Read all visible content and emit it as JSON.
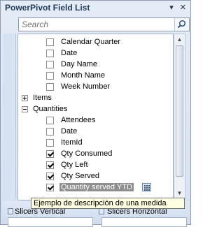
{
  "window": {
    "title": "PowerPivot Field List",
    "controls": [
      "▾",
      "✕"
    ]
  },
  "search": {
    "placeholder": "Search",
    "button_icon": "search-icon"
  },
  "fields": [
    {
      "label": "Calendar Quarter",
      "type": "field",
      "checked": false
    },
    {
      "label": "Date",
      "type": "field",
      "checked": false
    },
    {
      "label": "Day Name",
      "type": "field",
      "checked": false
    },
    {
      "label": "Month Name",
      "type": "field",
      "checked": false
    },
    {
      "label": "Week Number",
      "type": "field",
      "checked": false
    },
    {
      "label": "Items",
      "type": "table",
      "expanded": false
    },
    {
      "label": "Quantities",
      "type": "table",
      "expanded": true
    },
    {
      "label": "Attendees",
      "type": "field",
      "checked": false
    },
    {
      "label": "Date",
      "type": "field",
      "checked": false
    },
    {
      "label": "ItemId",
      "type": "field",
      "checked": false
    },
    {
      "label": "Qty Consumed",
      "type": "field",
      "checked": true
    },
    {
      "label": "Qty Left",
      "type": "field",
      "checked": true
    },
    {
      "label": "Qty Served",
      "type": "field",
      "checked": true
    },
    {
      "label": "Quantity served YTD",
      "type": "measure",
      "checked": true,
      "selected": true,
      "icon": "calculator-icon"
    }
  ],
  "slicers": {
    "vertical_label": "Slicers Vertical",
    "horizontal_label": "Slicers Horizontal"
  },
  "tooltip": {
    "text": "Ejemplo de descripción de una medida"
  },
  "colors": {
    "panel_bg": "#d5e1f2",
    "border": "#8e9db5",
    "title_text": "#1e395b",
    "selection": "#8f8f8f",
    "tooltip_bg": "#ffffe1"
  }
}
